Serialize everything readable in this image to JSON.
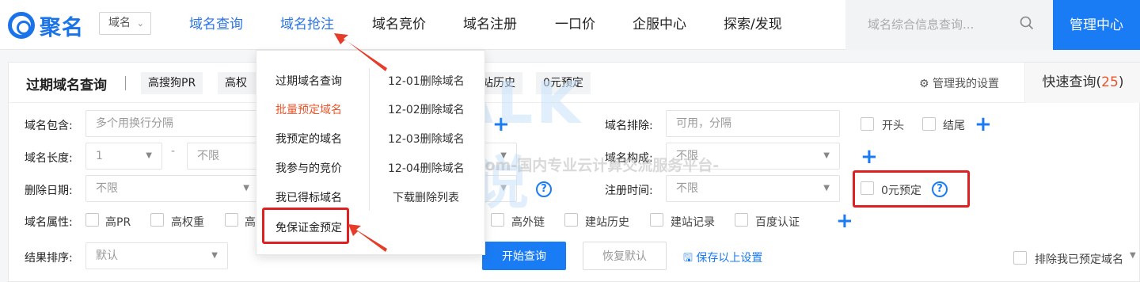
{
  "header": {
    "logo_text": "聚名",
    "scope_select": "域名",
    "nav": [
      "域名查询",
      "域名抢注",
      "域名竞价",
      "域名注册",
      "一口价",
      "企服中心",
      "探索/发现"
    ],
    "active_nav": "域名抢注",
    "search_placeholder": "域名综合信息查询...",
    "manage_button": "管理中心"
  },
  "panel": {
    "title": "过期域名查询",
    "chips": [
      "高搜狗PR",
      "高权重",
      "站历史",
      "0元预定"
    ],
    "settings_label": "管理我的设置",
    "quick_label": "快速查询(",
    "quick_count": "25",
    "quick_close": ")"
  },
  "form": {
    "contains_label": "域名包含:",
    "contains_placeholder": "多个用换行分隔",
    "exclude_label": "域名排除:",
    "exclude_placeholder": "可用，分隔",
    "start_label": "开头",
    "end_label": "结尾",
    "length_label": "域名长度:",
    "length_min": "1",
    "length_dash": "-",
    "length_max": "不限",
    "composition_label": "域名构成:",
    "composition_value": "不限",
    "delete_date_label": "删除日期:",
    "delete_date_value": "不限",
    "reg_time_label": "注册时间:",
    "reg_time_value": "不限",
    "zero_reserve_label": "0元预定",
    "attr_label": "域名属性:",
    "attrs_left": [
      "高PR",
      "高权重",
      "高"
    ],
    "attrs_right": [
      "高外链",
      "建站历史",
      "建站记录",
      "百度认证"
    ],
    "sort_label": "结果排序:",
    "sort_value": "默认",
    "start_button": "开始查询",
    "reset_button": "恢复默认",
    "save_link": "保存以上设置",
    "exclude_mine_label": "排除我已预定域名"
  },
  "dropdown": {
    "left": [
      "过期域名查询",
      "批量预定域名",
      "我预定的域名",
      "我参与的竞价",
      "我已得标域名",
      "免保证金预定"
    ],
    "highlight_left": "批量预定域名",
    "right": [
      "12-01删除域名",
      "12-02删除域名",
      "12-03删除域名",
      "12-04删除域名",
      "下载删除列表"
    ]
  },
  "watermark": {
    "brand": "TALK云说",
    "url_line": "-www.idctalk.com-国内专业云计算交流服务平台-"
  },
  "colors": {
    "accent": "#1a7cf5",
    "highlight_red": "#e02020",
    "active_orange": "#e8552b"
  }
}
